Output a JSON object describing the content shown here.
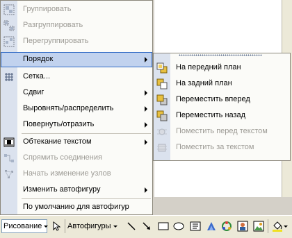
{
  "menu": {
    "items": [
      {
        "label": "Группировать",
        "disabled": true,
        "icon": "group-icon",
        "submenu": false
      },
      {
        "label": "Разгруппировать",
        "disabled": true,
        "icon": "ungroup-icon",
        "submenu": false
      },
      {
        "label": "Перегруппировать",
        "disabled": true,
        "icon": "regroup-icon",
        "submenu": false
      },
      {
        "label": "Порядок",
        "disabled": false,
        "selected": true,
        "submenu": true
      },
      {
        "label": "Сетка...",
        "disabled": false,
        "icon": "grid-icon",
        "submenu": false
      },
      {
        "label": "Сдвиг",
        "disabled": false,
        "submenu": true
      },
      {
        "label": "Выровнять/распределить",
        "disabled": false,
        "submenu": true
      },
      {
        "label": "Повернуть/отразить",
        "disabled": false,
        "submenu": true
      },
      {
        "label": "Обтекание текстом",
        "disabled": false,
        "icon": "text-wrap-icon",
        "submenu": true
      },
      {
        "label": "Спрямить соединения",
        "disabled": true,
        "icon": "straighten-connectors-icon",
        "submenu": false
      },
      {
        "label": "Начать изменение узлов",
        "disabled": true,
        "icon": "edit-points-icon",
        "submenu": false
      },
      {
        "label": "Изменить автофигуру",
        "disabled": false,
        "submenu": true
      },
      {
        "label": "По умолчанию для автофигур",
        "disabled": false,
        "submenu": false
      }
    ]
  },
  "submenu": {
    "items": [
      {
        "label": "На передний план",
        "disabled": false,
        "icon": "bring-to-front-icon"
      },
      {
        "label": "На задний план",
        "disabled": false,
        "icon": "send-to-back-icon"
      },
      {
        "label": "Переместить вперед",
        "disabled": false,
        "icon": "bring-forward-icon"
      },
      {
        "label": "Переместить назад",
        "disabled": false,
        "icon": "send-backward-icon"
      },
      {
        "label": "Поместить перед текстом",
        "disabled": true,
        "icon": "in-front-of-text-icon"
      },
      {
        "label": "Поместить за текстом",
        "disabled": true,
        "icon": "behind-text-icon"
      }
    ]
  },
  "toolbar": {
    "drawing_label": "Рисование",
    "autoshapes_label": "Автофигуры",
    "tools": [
      "select-objects-icon",
      "line-icon",
      "arrow-icon",
      "rectangle-icon",
      "oval-icon",
      "text-box-icon",
      "wordart-icon",
      "diagram-icon",
      "clip-art-icon",
      "picture-icon",
      "fill-color-icon"
    ]
  },
  "colors": {
    "gutter": "#dbe2ee",
    "highlight": "#c1d2ee",
    "highlight_border": "#316ac5",
    "disabled_text": "#9c9a94"
  }
}
